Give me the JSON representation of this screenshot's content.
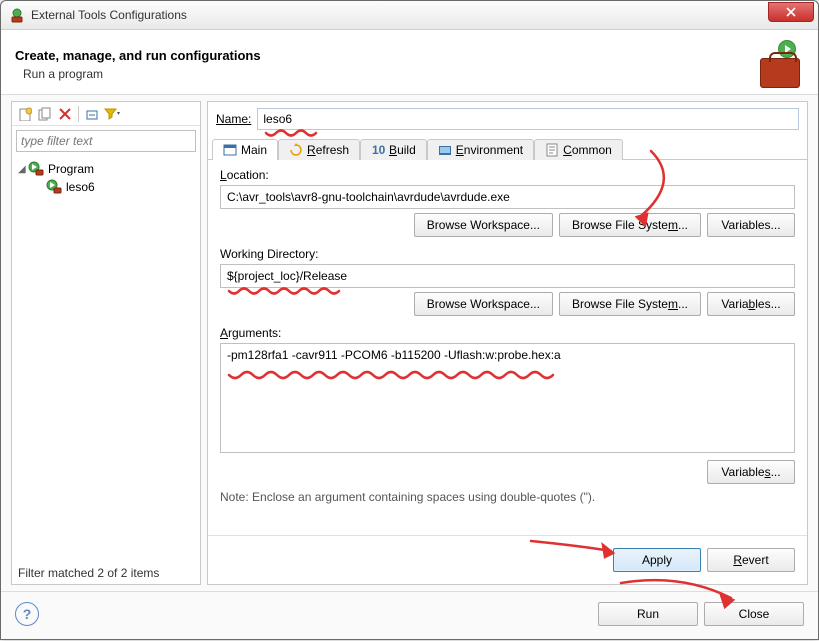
{
  "window": {
    "title": "External Tools Configurations"
  },
  "header": {
    "title": "Create, manage, and run configurations",
    "subtitle": "Run a program"
  },
  "left": {
    "filter_placeholder": "type filter text",
    "tree": {
      "root_label": "Program",
      "child_label": "leso6"
    },
    "status": "Filter matched 2 of 2 items"
  },
  "form": {
    "name_label": "Name:",
    "name_value": "leso6",
    "tabs": {
      "main": "Main",
      "refresh": "Refresh",
      "build": "Build",
      "environment": "Environment",
      "common": "Common"
    },
    "location": {
      "label_pre": "L",
      "label_rest": "ocation:",
      "value": "C:\\avr_tools\\avr8-gnu-toolchain\\avrdude\\avrdude.exe"
    },
    "workdir": {
      "label": "Working Directory:",
      "value": "${project_loc}/Release"
    },
    "arguments": {
      "label_pre": "A",
      "label_rest": "rguments:",
      "value": "-pm128rfa1 -cavr911 -PCOM6 -b115200 -Uflash:w:probe.hex:a"
    },
    "buttons": {
      "browse_ws": "Browse Workspace...",
      "browse_fs_pre": "Browse File Syste",
      "browse_fs_ul": "m",
      "browse_fs_post": "...",
      "variables": "Variables...",
      "variables_ul_pre": "Varia",
      "variables_ul": "b",
      "variables_ul_post": "les...",
      "variables_s_pre": "Variable",
      "variables_s_ul": "s",
      "variables_s_post": "...",
      "apply": "Apply",
      "revert_ul": "R",
      "revert_rest": "evert",
      "run": "Run",
      "close": "Close"
    },
    "note": "Note: Enclose an argument containing spaces using double-quotes (\")."
  },
  "icons": {
    "new": "new-icon",
    "duplicate": "duplicate-icon",
    "delete": "delete-icon",
    "collapse": "collapse-icon",
    "filter": "filter-icon"
  }
}
